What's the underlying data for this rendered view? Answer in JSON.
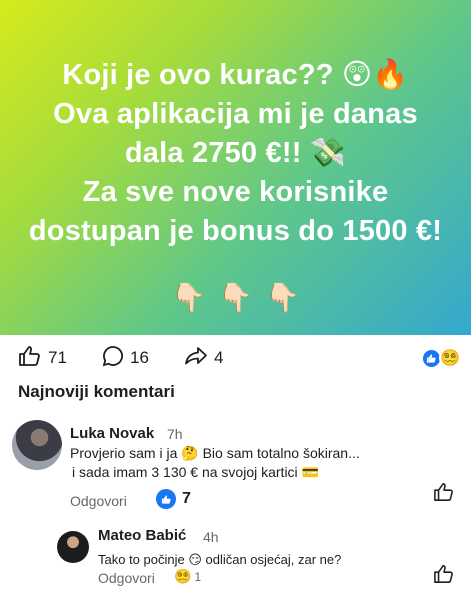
{
  "banner": {
    "lines": [
      "Koji je ovo kurac?? 😲🔥",
      "Ova aplikacija mi je danas",
      "dala 2750 €!! 💸",
      "Za sve nove korisnike",
      "dostupan je bonus do 1500 €!"
    ],
    "pointers": [
      "👇🏻",
      "👇🏻",
      "👇🏻"
    ]
  },
  "post_stats": {
    "likes": "71",
    "comments": "16",
    "shares": "4",
    "reactions": [
      "like",
      "😵‍💫"
    ]
  },
  "comments_section": {
    "title": "Najnoviji komentari",
    "comments": [
      {
        "author": "Luka Novak",
        "time": "7h",
        "text_line1": "Provjerio sam i ja 🤔 Bio sam totalno šokiran...",
        "text_line2": "i sada imam 3 130 € na svojoj kartici 💳",
        "reply_label": "Odgovori",
        "like_count": "7"
      },
      {
        "author": "Mateo Babić",
        "time": "4h",
        "text": "Tako to počinje 😏 odličan osjećaj, zar ne?",
        "reply_label": "Odgovori",
        "reaction_emoji": "😵‍💫",
        "reaction_count": "1"
      }
    ]
  },
  "colors": {
    "accent": "#1877f2",
    "muted_text": "#65676b",
    "banner_gradient": [
      "#d6ea1e",
      "#a6dc3b",
      "#5fc78a",
      "#33a8cf"
    ]
  }
}
